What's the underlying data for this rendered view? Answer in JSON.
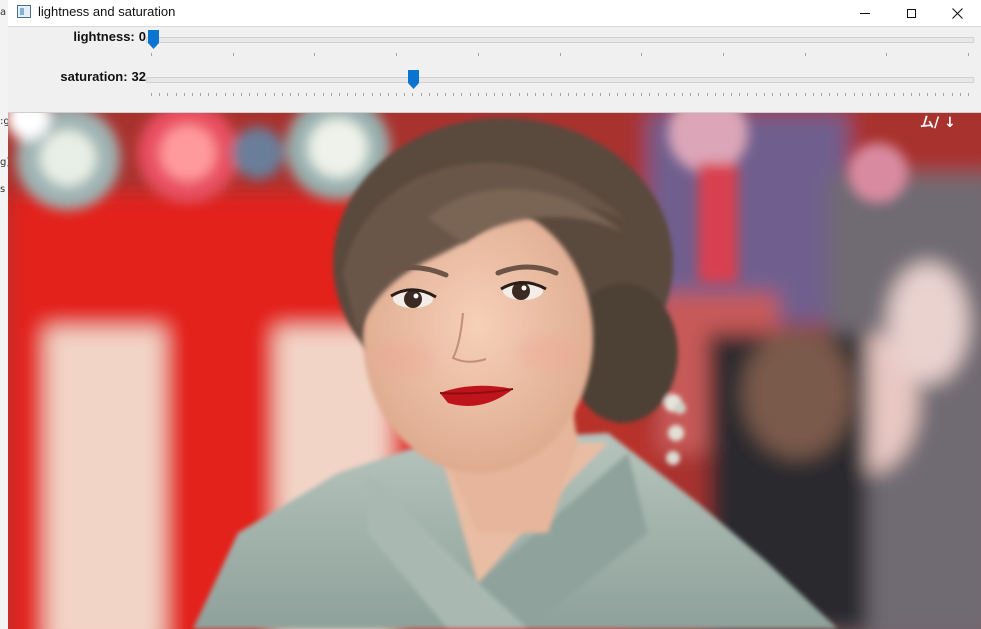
{
  "window": {
    "title": "lightness and saturation"
  },
  "background_fragments": [
    "a",
    ":g",
    "g)",
    "s"
  ],
  "trackbars": [
    {
      "name": "lightness",
      "label": "lightness:",
      "value": 0,
      "max": 100,
      "position_fraction": 0.0
    },
    {
      "name": "saturation",
      "label": "saturation:",
      "value": 32,
      "max": 100,
      "position_fraction": 0.32
    }
  ],
  "image": {
    "corner_text": "ム/ ↓",
    "colors": {
      "booth_red": "#e3201f",
      "stripe_white": "#f2d4c6",
      "kimono": "#9fb0a8",
      "hair": "#5a4a3e",
      "skin": "#efc2a8",
      "lips": "#c0141c"
    }
  },
  "colors": {
    "accent": "#0a74d1",
    "titlebar_bg": "#ffffff",
    "panel_bg": "#f0f0f0"
  }
}
